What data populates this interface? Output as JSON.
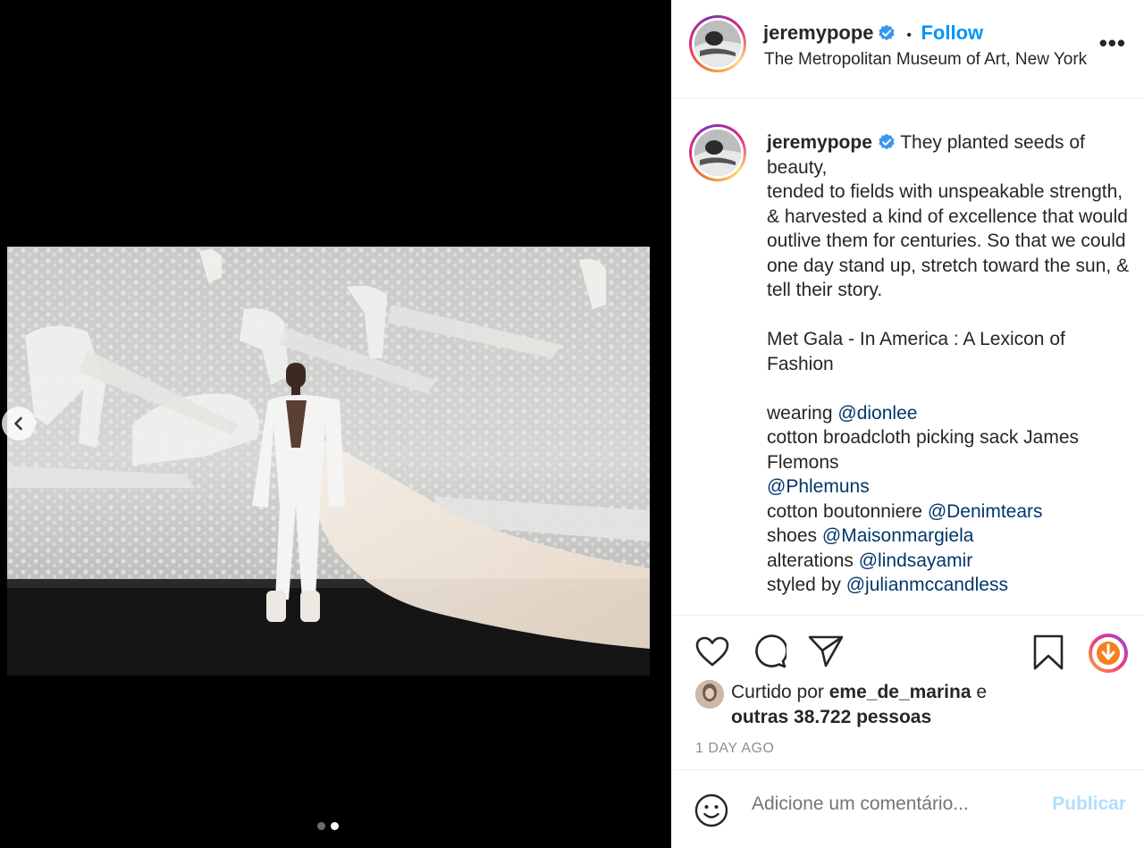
{
  "post": {
    "author": "jeremypope",
    "follow_label": "Follow",
    "separator": "•",
    "location": "The Metropolitan Museum of Art, New York",
    "more_label": "•••"
  },
  "caption": {
    "author": "jeremypope",
    "lines": [
      "They planted seeds of beauty,",
      "tended to fields with unspeakable strength,",
      "& harvested a kind of excellence that would outlive them for centuries. So that we could one day stand up, stretch toward the sun, & tell their story.",
      "Met Gala - In America : A Lexicon of Fashion",
      "wearing",
      "@dionlee",
      "cotton broadcloth picking sack James Flemons",
      "@Phlemuns",
      "cotton boutonniere",
      "@Denimtears",
      "shoes",
      "@Maisonmargiela",
      "alterations",
      "@lindsayamir",
      "styled by",
      "@julianmccandless"
    ]
  },
  "engagement": {
    "liked_prefix": "Curtido por",
    "liked_user": "eme_de_marina",
    "liked_connector": "e",
    "liked_others": "outras 38.722 pessoas",
    "timestamp": "1 DAY AGO"
  },
  "comment": {
    "placeholder": "Adicione um comentário...",
    "publish_label": "Publicar"
  },
  "icons": {
    "like": "heart-icon",
    "comment": "comment-bubble-icon",
    "share": "paper-plane-icon",
    "save": "bookmark-icon",
    "download": "download-icon",
    "emoji": "smiley-icon",
    "prev": "chevron-left-icon",
    "verified": "verified-badge-icon"
  },
  "carousel": {
    "total": 2,
    "current": 2
  },
  "colors": {
    "accent": "#0095f6",
    "mention": "#00376b",
    "muted": "#8e8e8e",
    "publish_disabled": "#b2dffc",
    "verified": "#3897f0"
  }
}
